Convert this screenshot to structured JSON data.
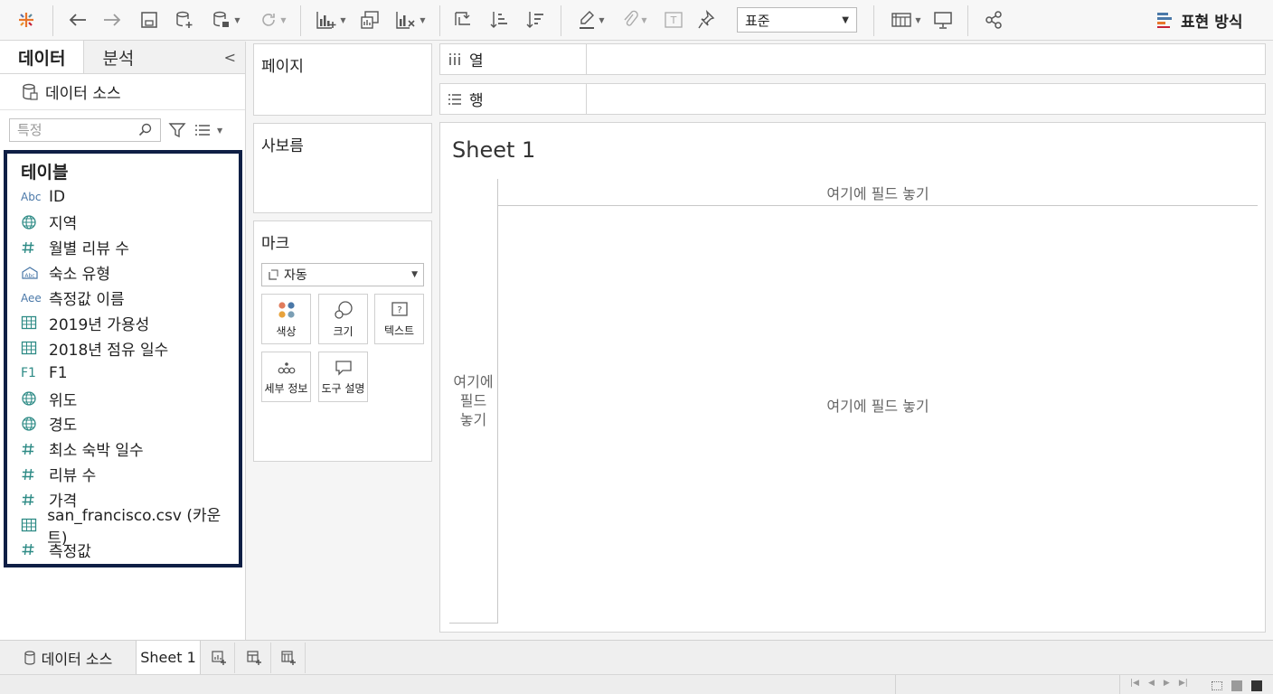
{
  "toolbar": {
    "fit_select": "표준",
    "show_me": "표현 방식"
  },
  "left_panel": {
    "tabs": [
      "데이터",
      "분석"
    ],
    "data_source": "데이터 소스",
    "search_placeholder": "특정",
    "tables_title": "테이블",
    "fields": [
      {
        "icon": "Abc",
        "name": "ID"
      },
      {
        "icon": "globe",
        "name": "지역"
      },
      {
        "icon": "#",
        "name": "월별 리뷰 수"
      },
      {
        "icon": "group",
        "name": "숙소 유형"
      },
      {
        "icon": "Aee",
        "name": "측정값 이름"
      },
      {
        "icon": "table",
        "name": "2019년 가용성"
      },
      {
        "icon": "table",
        "name": "2018년 점유 일수"
      },
      {
        "icon": "F1",
        "name": "F1"
      },
      {
        "icon": "globe",
        "name": "위도"
      },
      {
        "icon": "globe",
        "name": "경도"
      },
      {
        "icon": "#",
        "name": "최소 숙박 일수"
      },
      {
        "icon": "#",
        "name": "리뷰 수"
      },
      {
        "icon": "#",
        "name": "가격"
      },
      {
        "icon": "table",
        "name": "san_francisco.csv (카운트)"
      },
      {
        "icon": "#",
        "name": "측정값"
      }
    ]
  },
  "middle_panel": {
    "pages": "페이지",
    "filters": "사보름",
    "marks": "마크",
    "marks_type": "자동",
    "mark_buttons": [
      "색상",
      "크기",
      "텍스트",
      "세부 정보",
      "도구 설명"
    ]
  },
  "shelves": {
    "columns": "열",
    "rows": "행"
  },
  "view": {
    "sheet_title": "Sheet 1",
    "drop_top": "여기에 필드 놓기",
    "drop_left": "여기에 필드 놓기",
    "drop_center": "여기에 필드 놓기"
  },
  "bottom_bar": {
    "data_source": "데이터 소스",
    "sheet": "Sheet 1"
  },
  "colors": {
    "tables_border": "#0f1f45",
    "dimension_icon": "#4a78a8",
    "measure_icon": "#2e8b86"
  }
}
